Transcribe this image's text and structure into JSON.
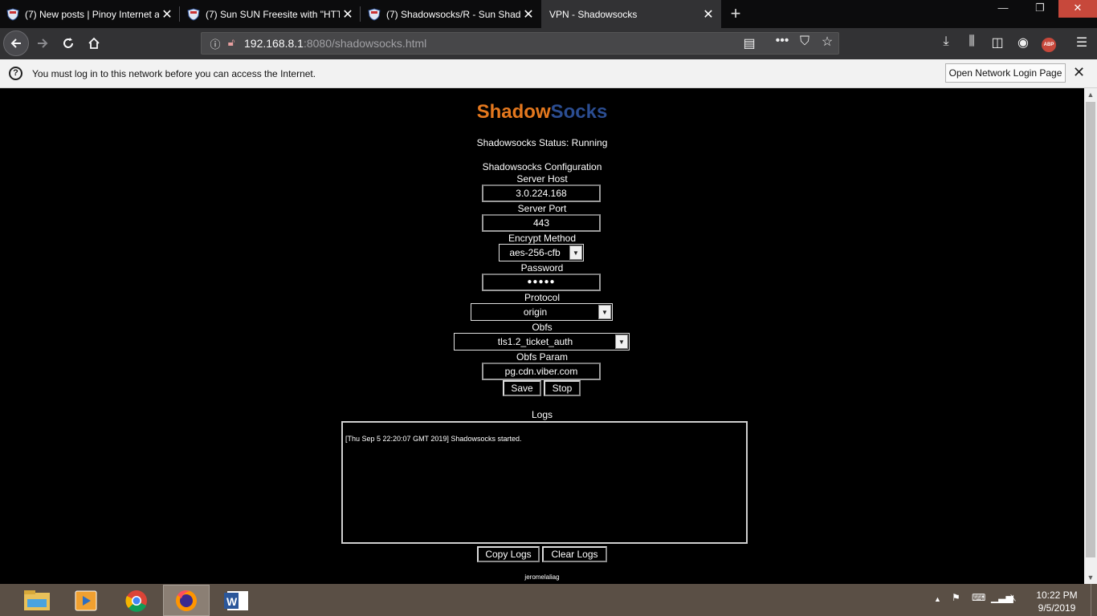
{
  "browser": {
    "tabs": [
      {
        "title": "(7) New posts | Pinoy Internet a",
        "active": false
      },
      {
        "title": "(7) Sun SUN Freesite with \"HTT",
        "active": false
      },
      {
        "title": "(7) Shadowsocks/R - Sun Shado",
        "active": false
      },
      {
        "title": "VPN - Shadowsocks",
        "active": true
      }
    ],
    "url_host": "192.168.8.1",
    "url_rest": ":8080/shadowsocks.html",
    "notification": {
      "text": "You must log in to this network before you can access the Internet.",
      "button": "Open Network Login Page"
    },
    "toolbar_icons": [
      "back-icon",
      "forward-icon",
      "reload-icon",
      "home-icon",
      "reader-view-icon",
      "more-icon",
      "pocket-icon",
      "bookmark-star-icon",
      "download-icon",
      "library-icon",
      "sidebar-icon",
      "account-icon",
      "adblock-icon",
      "menu-icon"
    ]
  },
  "page": {
    "logo_part1": "Shadow",
    "logo_part2": "Socks",
    "status_text": "Shadowsocks Status: Running",
    "config_heading": "Shadowsocks Configuration",
    "server_host_label": "Server Host",
    "server_host_value": "3.0.224.168",
    "server_port_label": "Server Port",
    "server_port_value": "443",
    "encrypt_label": "Encrypt Method",
    "encrypt_value": "aes-256-cfb",
    "password_label": "Password",
    "password_value": "●●●●●",
    "protocol_label": "Protocol",
    "protocol_value": "origin",
    "obfs_label": "Obfs",
    "obfs_value": "tls1.2_ticket_auth",
    "obfs_param_label": "Obfs Param",
    "obfs_param_value": "pg.cdn.viber.com",
    "save_label": "Save",
    "stop_label": "Stop",
    "logs_heading": "Logs",
    "log_line": "[Thu Sep  5 22:20:07 GMT 2019] Shadowsocks started.",
    "copy_logs_label": "Copy Logs",
    "clear_logs_label": "Clear Logs",
    "credit": "jeromelaliag"
  },
  "taskbar": {
    "apps": [
      "file-explorer-icon",
      "media-player-icon",
      "chrome-icon",
      "firefox-icon",
      "word-icon"
    ],
    "time": "10:22 PM",
    "date": "9/5/2019"
  },
  "colors": {
    "logo_orange": "#e4781e",
    "logo_blue": "#2b4d91",
    "close_red": "#c7483b"
  }
}
